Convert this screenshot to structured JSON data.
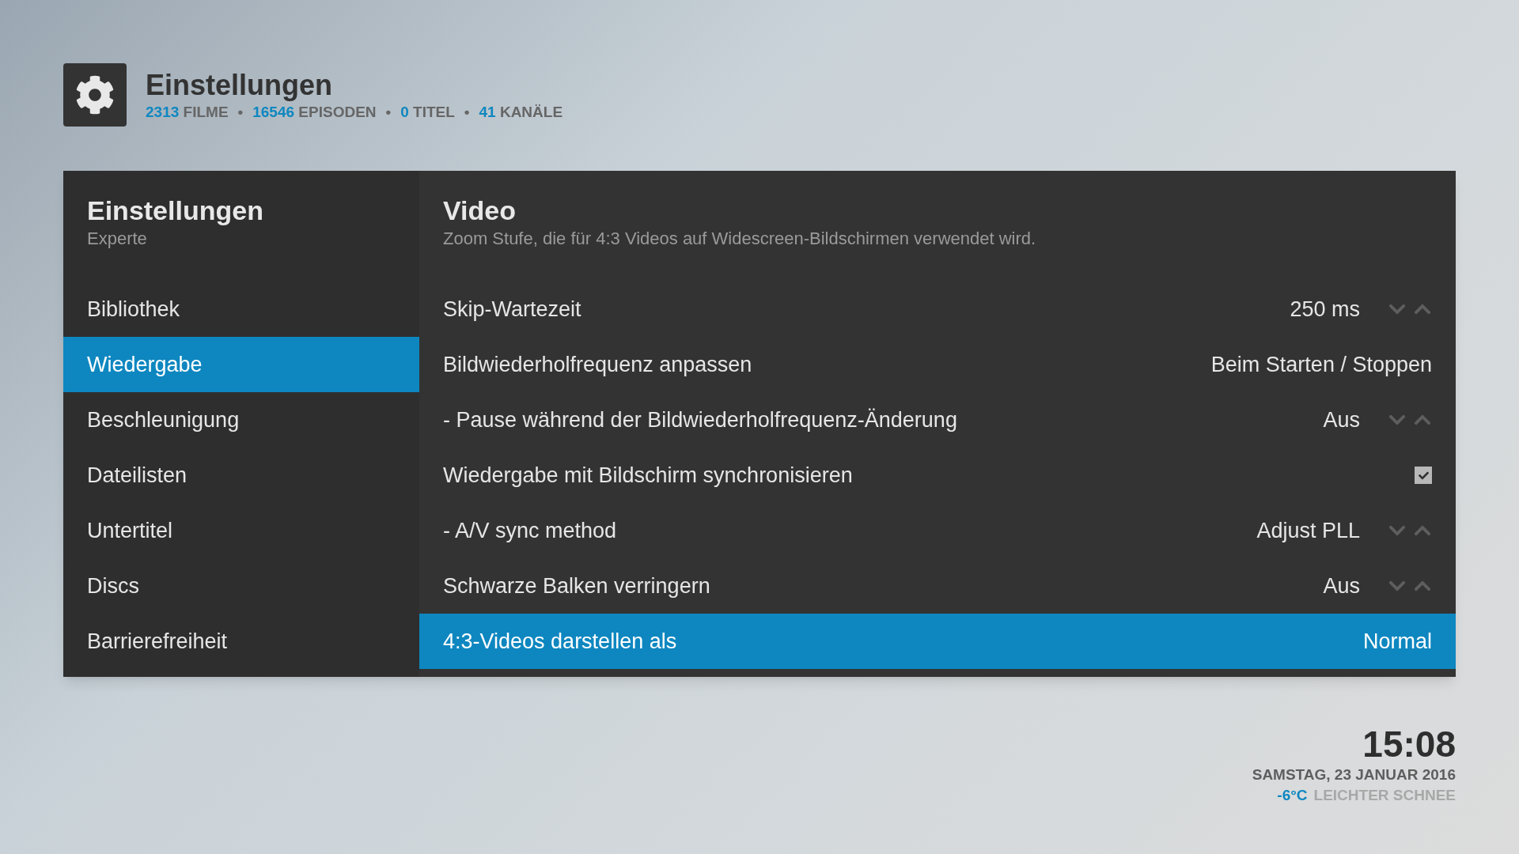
{
  "header": {
    "title": "Einstellungen",
    "stats": [
      {
        "count": "2313",
        "label": "FILME"
      },
      {
        "count": "16546",
        "label": "EPISODEN"
      },
      {
        "count": "0",
        "label": "TITEL"
      },
      {
        "count": "41",
        "label": "KANÄLE"
      }
    ],
    "separator": "•"
  },
  "sidebar": {
    "title": "Einstellungen",
    "level": "Experte",
    "items": [
      {
        "label": "Bibliothek",
        "selected": false
      },
      {
        "label": "Wiedergabe",
        "selected": true
      },
      {
        "label": "Beschleunigung",
        "selected": false
      },
      {
        "label": "Dateilisten",
        "selected": false
      },
      {
        "label": "Untertitel",
        "selected": false
      },
      {
        "label": "Discs",
        "selected": false
      },
      {
        "label": "Barrierefreiheit",
        "selected": false
      }
    ]
  },
  "content": {
    "title": "Video",
    "description": "Zoom Stufe, die für 4:3 Videos auf Widescreen-Bildschirmen verwendet wird.",
    "settings": [
      {
        "kind": "spinner",
        "label": "Skip-Wartezeit",
        "value": "250 ms",
        "selected": false
      },
      {
        "kind": "list",
        "label": "Bildwiederholfrequenz anpassen",
        "value": "Beim Starten / Stoppen",
        "selected": false
      },
      {
        "kind": "spinner",
        "label": "- Pause während der Bildwiederholfrequenz-Änderung",
        "value": "Aus",
        "selected": false
      },
      {
        "kind": "checkbox",
        "label": "Wiedergabe mit Bildschirm synchronisieren",
        "checked": true,
        "selected": false
      },
      {
        "kind": "spinner",
        "label": "- A/V sync method",
        "value": "Adjust PLL",
        "selected": false
      },
      {
        "kind": "spinner",
        "label": "Schwarze Balken verringern",
        "value": "Aus",
        "selected": false
      },
      {
        "kind": "list",
        "label": "4:3-Videos darstellen als",
        "value": "Normal",
        "selected": true
      }
    ]
  },
  "clock": {
    "time": "15:08",
    "date": "SAMSTAG, 23 JANUAR 2016",
    "temperature": "-6°C",
    "condition": "LEICHTER SCHNEE"
  }
}
